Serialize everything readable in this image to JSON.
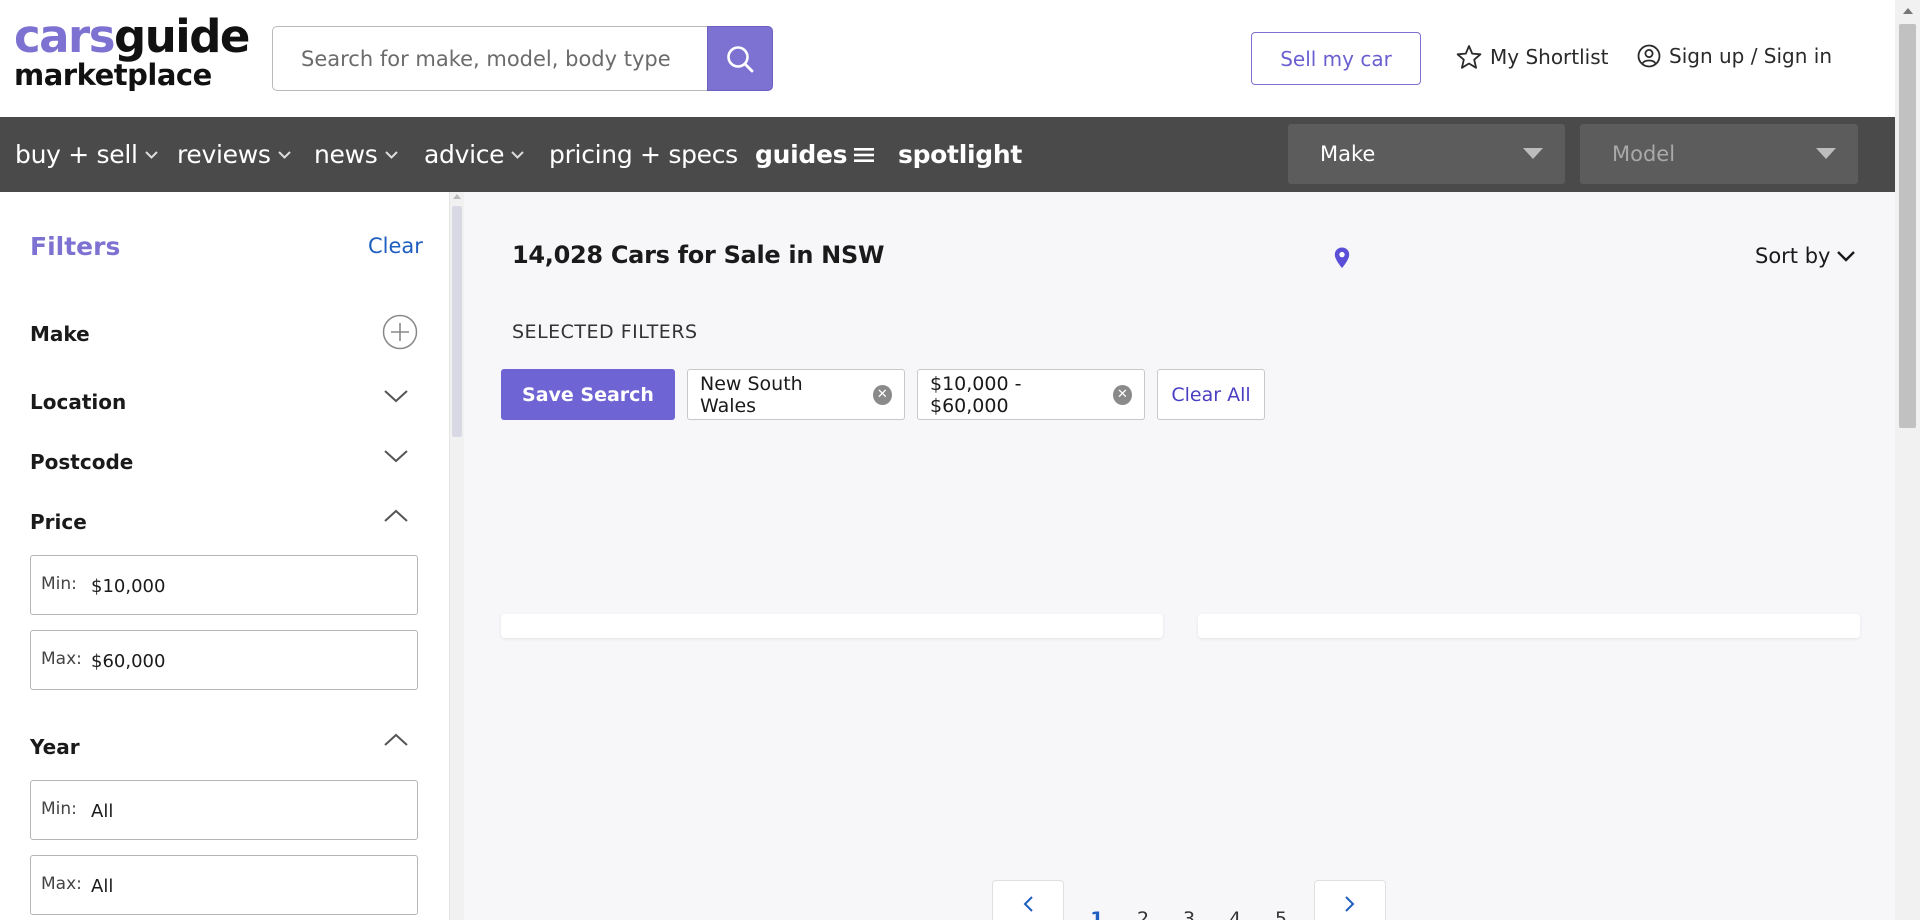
{
  "header": {
    "logo_top_a": "cars",
    "logo_top_b": "guide",
    "logo_bottom": "marketplace",
    "search_placeholder": "Search for make, model, body type",
    "sell_label": "Sell my car",
    "shortlist_label": "My Shortlist",
    "signin_label": "Sign up / Sign in"
  },
  "nav": {
    "items": [
      {
        "label": "buy + sell"
      },
      {
        "label": "reviews"
      },
      {
        "label": "news"
      },
      {
        "label": "advice"
      },
      {
        "label": "pricing + specs"
      },
      {
        "label": "guides"
      },
      {
        "label": "spotlight"
      }
    ],
    "make_label": "Make",
    "model_label": "Model"
  },
  "sidebar": {
    "title": "Filters",
    "clear_label": "Clear",
    "sections": {
      "make": "Make",
      "location": "Location",
      "postcode": "Postcode",
      "price": "Price",
      "year": "Year"
    },
    "price": {
      "min_label": "Min:",
      "min_value": "$10,000",
      "max_label": "Max:",
      "max_value": "$60,000"
    },
    "year": {
      "min_label": "Min:",
      "min_value": "All",
      "max_label": "Max:",
      "max_value": "All"
    }
  },
  "main": {
    "results_title": "14,028 Cars for Sale in NSW",
    "sort_label": "Sort by",
    "selected_filters_label": "SELECTED FILTERS",
    "save_search_label": "Save Search",
    "chips": [
      {
        "label": "New South Wales"
      },
      {
        "label": "$10,000 - $60,000"
      }
    ],
    "clear_all_label": "Clear All",
    "pagination": {
      "pages": [
        "1",
        "2",
        "3",
        "4",
        "5"
      ],
      "active_page": "1"
    }
  },
  "colors": {
    "brand_purple": "#7d72d1",
    "nav_bg": "#4a4a4a",
    "link_blue": "#1f5fbf"
  }
}
